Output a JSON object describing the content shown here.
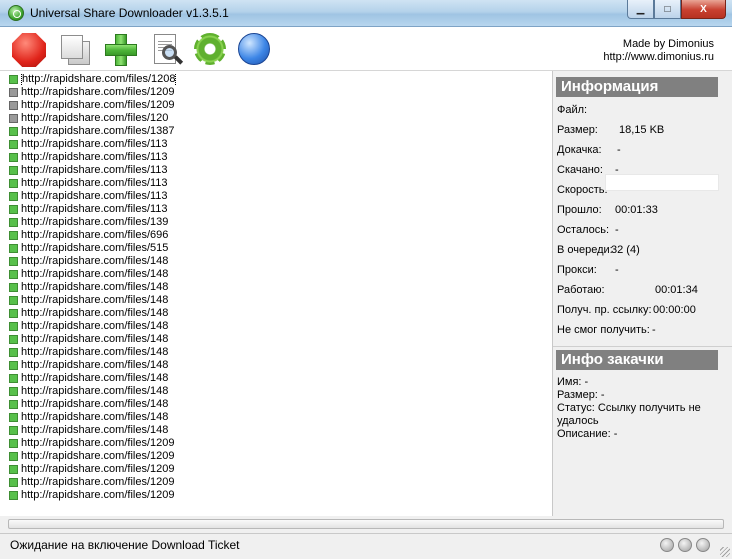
{
  "window": {
    "title": "Universal Share Downloader v1.3.5.1",
    "minimize_glyph": "▁",
    "maximize_glyph": "□",
    "close_glyph": "X"
  },
  "toolbar": {
    "buttons": [
      {
        "icon": "stop-icon"
      },
      {
        "icon": "copy-icon"
      },
      {
        "icon": "add-icon"
      },
      {
        "icon": "search-document-icon"
      },
      {
        "icon": "settings-gear-icon"
      },
      {
        "icon": "info-globe-icon"
      }
    ],
    "credit_line1": "Made by Dimonius",
    "credit_line2": "http://www.dimonius.ru"
  },
  "links": [
    {
      "text": "http://rapidshare.com/files/1208",
      "status": "green",
      "selected": true
    },
    {
      "text": "http://rapidshare.com/files/1209",
      "status": "gray"
    },
    {
      "text": "http://rapidshare.com/files/1209",
      "status": "gray"
    },
    {
      "text": "http://rapidshare.com/files/120",
      "status": "gray"
    },
    {
      "text": "http://rapidshare.com/files/1387",
      "status": "green"
    },
    {
      "text": "http://rapidshare.com/files/113",
      "status": "green"
    },
    {
      "text": "http://rapidshare.com/files/113",
      "status": "green"
    },
    {
      "text": "http://rapidshare.com/files/113",
      "status": "green"
    },
    {
      "text": "http://rapidshare.com/files/113",
      "status": "green"
    },
    {
      "text": "http://rapidshare.com/files/113",
      "status": "green"
    },
    {
      "text": "http://rapidshare.com/files/113",
      "status": "green"
    },
    {
      "text": "http://rapidshare.com/files/139",
      "status": "green"
    },
    {
      "text": "http://rapidshare.com/files/696",
      "status": "green"
    },
    {
      "text": "http://rapidshare.com/files/515",
      "status": "green"
    },
    {
      "text": "http://rapidshare.com/files/148",
      "status": "green"
    },
    {
      "text": "http://rapidshare.com/files/148",
      "status": "green"
    },
    {
      "text": "http://rapidshare.com/files/148",
      "status": "green"
    },
    {
      "text": "http://rapidshare.com/files/148",
      "status": "green"
    },
    {
      "text": "http://rapidshare.com/files/148",
      "status": "green"
    },
    {
      "text": "http://rapidshare.com/files/148",
      "status": "green"
    },
    {
      "text": "http://rapidshare.com/files/148",
      "status": "green"
    },
    {
      "text": "http://rapidshare.com/files/148",
      "status": "green"
    },
    {
      "text": "http://rapidshare.com/files/148",
      "status": "green"
    },
    {
      "text": "http://rapidshare.com/files/148",
      "status": "green"
    },
    {
      "text": "http://rapidshare.com/files/148",
      "status": "green"
    },
    {
      "text": "http://rapidshare.com/files/148",
      "status": "green"
    },
    {
      "text": "http://rapidshare.com/files/148",
      "status": "green"
    },
    {
      "text": "http://rapidshare.com/files/148",
      "status": "green"
    },
    {
      "text": "http://rapidshare.com/files/1209",
      "status": "green"
    },
    {
      "text": "http://rapidshare.com/files/1209",
      "status": "green"
    },
    {
      "text": "http://rapidshare.com/files/1209",
      "status": "green"
    },
    {
      "text": "http://rapidshare.com/files/1209",
      "status": "green"
    },
    {
      "text": "http://rapidshare.com/files/1209",
      "status": "green"
    }
  ],
  "info": {
    "header": "Информация",
    "rows": [
      {
        "label": "Файл:",
        "value": ""
      },
      {
        "label": "Размер:",
        "value": "18,15 KB"
      },
      {
        "label": "Докачка:",
        "value": "-"
      },
      {
        "label": "Скачано:",
        "value": "-"
      },
      {
        "label": "Скорость:",
        "value": "-"
      },
      {
        "label": "Прошло:",
        "value": "00:01:33"
      },
      {
        "label": "Осталось:",
        "value": "-"
      },
      {
        "label": "В очереди:",
        "value": "32 (4)"
      },
      {
        "label": "Прокси:",
        "value": "-"
      },
      {
        "label": "Работаю:",
        "value": "00:01:34"
      },
      {
        "label": "Получ. пр. ссылку:",
        "value": "00:00:00"
      },
      {
        "label": "Не смог получить:",
        "value": "-"
      }
    ]
  },
  "download_info": {
    "header": "Инфо закачки",
    "lines": [
      "Имя: -",
      "Размер: -",
      "Статус: Ссылку получить не удалось",
      "Описание: -"
    ]
  },
  "progress": {
    "fraction": 0.0
  },
  "statusbar": {
    "text": "Ожидание на включение Download Ticket"
  }
}
